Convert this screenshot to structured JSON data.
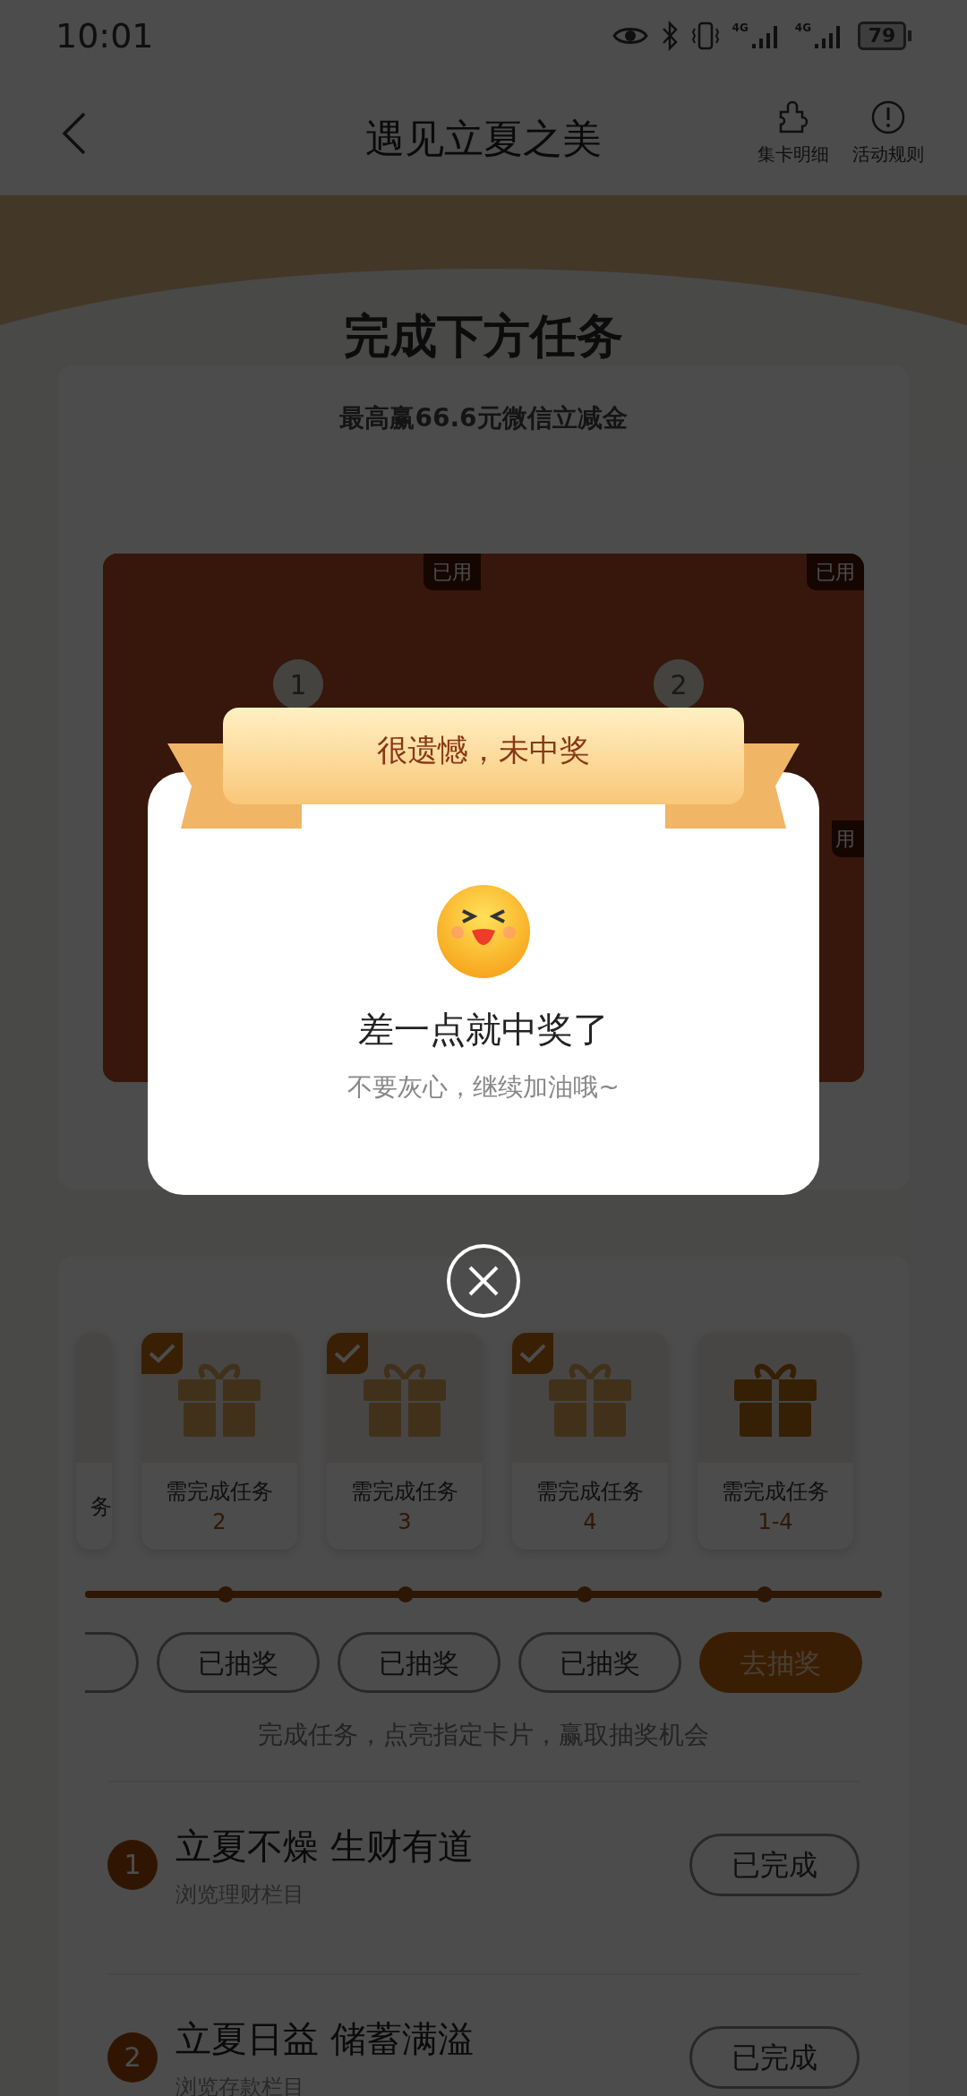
{
  "status_bar": {
    "time": "10:01",
    "signals": [
      {
        "label": "4G"
      },
      {
        "label": "4G"
      }
    ],
    "battery": "79"
  },
  "header": {
    "title": "遇见立夏之美",
    "actions": [
      {
        "kind": "puzzle",
        "label": "集卡明细"
      },
      {
        "kind": "info",
        "label": "活动规则"
      }
    ]
  },
  "banner": {
    "title": "完成下方任务"
  },
  "card_section": {
    "subtitle": "最高赢66.6元微信立减金",
    "badges": [
      "已用",
      "已用",
      "用"
    ],
    "markers": [
      "1",
      "2"
    ]
  },
  "rewards": [
    {
      "text": "务"
    },
    {
      "text": "需完成任务",
      "task": "2",
      "checked": true
    },
    {
      "text": "需完成任务",
      "task": "3",
      "checked": true
    },
    {
      "text": "需完成任务",
      "task": "4",
      "checked": true
    },
    {
      "text": "需完成任务",
      "task": "1-4",
      "checked": false
    }
  ],
  "draw_buttons": [
    {
      "label": "已抽奖",
      "drawn": true
    },
    {
      "label": "已抽奖",
      "drawn": true
    },
    {
      "label": "已抽奖",
      "drawn": true
    },
    {
      "label": "去抽奖",
      "drawn": false
    }
  ],
  "hint": "完成任务，点亮指定卡片，赢取抽奖机会",
  "tasks": [
    {
      "number": "1",
      "title": "立夏不燥 生财有道",
      "subtitle": "浏览理财栏目",
      "button": "已完成",
      "completed": true
    },
    {
      "number": "2",
      "title": "立夏日益 储蓄满溢",
      "subtitle": "浏览存款栏目",
      "button": "已完成",
      "completed": true
    }
  ],
  "dialog": {
    "ribbon": "很遗憾，未中奖",
    "title": "差一点就中奖了",
    "message": "不要灰心，继续加油哦~"
  }
}
